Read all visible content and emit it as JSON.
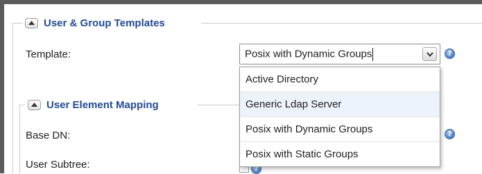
{
  "sections": {
    "templates": {
      "title": "User & Group Templates"
    },
    "mapping": {
      "title": "User Element Mapping"
    }
  },
  "fields": {
    "template_label": "Template:",
    "base_dn_label": "Base DN:",
    "user_subtree_label": "User Subtree:"
  },
  "template_select": {
    "value": "Posix with Dynamic Groups",
    "open": true,
    "options": [
      "Active Directory",
      "Generic Ldap Server",
      "Posix with Dynamic Groups",
      "Posix with Static Groups"
    ],
    "hovered_option": "Generic Ldap Server"
  },
  "colors": {
    "accent": "#234a95",
    "frame": "#5b5b5b",
    "hover": "#edf3fb"
  },
  "icons": {
    "collapse": "collapse-up-icon",
    "help": "help-icon",
    "dropdown": "chevron-down-icon"
  }
}
